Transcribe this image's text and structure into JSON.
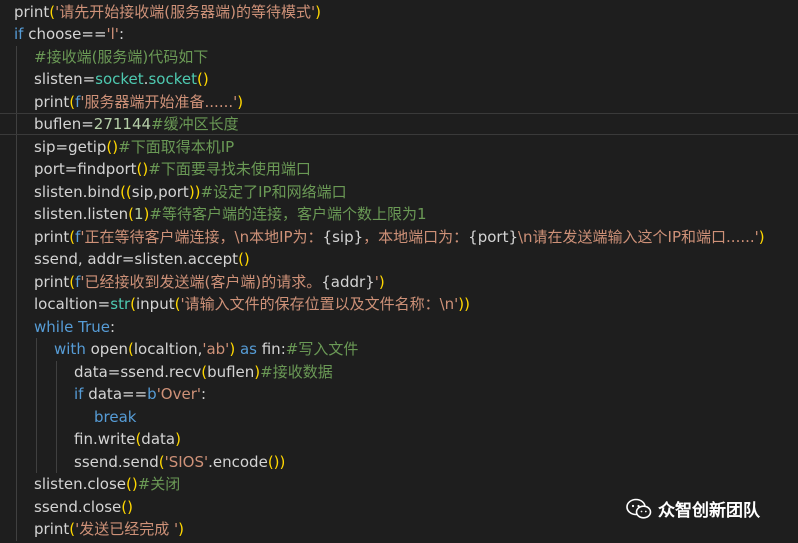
{
  "code": {
    "lines": [
      {
        "indent": 0,
        "tokens": [
          {
            "t": "print",
            "c": "w"
          },
          {
            "t": "(",
            "c": "br"
          },
          {
            "t": "'请先开始接收端(服务器端)的等待模式'",
            "c": "str"
          },
          {
            "t": ")",
            "c": "br"
          }
        ]
      },
      {
        "indent": 0,
        "tokens": [
          {
            "t": "if",
            "c": "kw"
          },
          {
            "t": " choose==",
            "c": "w"
          },
          {
            "t": "'l'",
            "c": "str"
          },
          {
            "t": ":",
            "c": "w"
          }
        ]
      },
      {
        "indent": 1,
        "tokens": [
          {
            "t": "#接收端(服务端)代码如下",
            "c": "cm"
          }
        ]
      },
      {
        "indent": 1,
        "tokens": [
          {
            "t": "slisten=",
            "c": "w"
          },
          {
            "t": "socket",
            "c": "cls"
          },
          {
            "t": ".",
            "c": "w"
          },
          {
            "t": "socket",
            "c": "cls"
          },
          {
            "t": "()",
            "c": "br"
          }
        ]
      },
      {
        "indent": 1,
        "tokens": [
          {
            "t": "print",
            "c": "w"
          },
          {
            "t": "(",
            "c": "br"
          },
          {
            "t": "f",
            "c": "kw"
          },
          {
            "t": "'服务器端开始准备......'",
            "c": "str"
          },
          {
            "t": ")",
            "c": "br"
          }
        ]
      },
      {
        "indent": 1,
        "active": true,
        "tokens": [
          {
            "t": "buflen=",
            "c": "w"
          },
          {
            "t": "271144",
            "c": "num"
          },
          {
            "t": "#缓冲区长度",
            "c": "cm"
          }
        ]
      },
      {
        "indent": 1,
        "tokens": [
          {
            "t": "sip=getip",
            "c": "w"
          },
          {
            "t": "()",
            "c": "br"
          },
          {
            "t": "#下面取得本机IP",
            "c": "cm"
          }
        ]
      },
      {
        "indent": 1,
        "tokens": [
          {
            "t": "port=findport",
            "c": "w"
          },
          {
            "t": "()",
            "c": "br"
          },
          {
            "t": "#下面要寻找未使用端口",
            "c": "cm"
          }
        ]
      },
      {
        "indent": 1,
        "tokens": [
          {
            "t": "slisten.bind",
            "c": "w"
          },
          {
            "t": "((",
            "c": "br"
          },
          {
            "t": "sip,port",
            "c": "w"
          },
          {
            "t": "))",
            "c": "br"
          },
          {
            "t": "#设定了IP和网络端口",
            "c": "cm"
          }
        ]
      },
      {
        "indent": 1,
        "tokens": [
          {
            "t": "slisten.listen",
            "c": "w"
          },
          {
            "t": "(",
            "c": "br"
          },
          {
            "t": "1",
            "c": "num"
          },
          {
            "t": ")",
            "c": "br"
          },
          {
            "t": "#等待客户端的连接，客户端个数上限为1",
            "c": "cm"
          }
        ]
      },
      {
        "indent": 1,
        "tokens": [
          {
            "t": "print",
            "c": "w"
          },
          {
            "t": "(",
            "c": "br"
          },
          {
            "t": "f",
            "c": "kw"
          },
          {
            "t": "'正在等待客户端连接，\\n本地IP为：",
            "c": "str"
          },
          {
            "t": "{sip}",
            "c": "w"
          },
          {
            "t": "，本地端口为：",
            "c": "str"
          },
          {
            "t": "{port}",
            "c": "w"
          },
          {
            "t": "\\n请在发送端输入这个IP和端口......'",
            "c": "str"
          },
          {
            "t": ")",
            "c": "br"
          }
        ]
      },
      {
        "indent": 1,
        "tokens": [
          {
            "t": "ssend, addr=slisten.accept",
            "c": "w"
          },
          {
            "t": "()",
            "c": "br"
          }
        ]
      },
      {
        "indent": 1,
        "tokens": [
          {
            "t": "print",
            "c": "w"
          },
          {
            "t": "(",
            "c": "br"
          },
          {
            "t": "f",
            "c": "kw"
          },
          {
            "t": "'已经接收到发送端(客户端)的请求。",
            "c": "str"
          },
          {
            "t": "{addr}",
            "c": "w"
          },
          {
            "t": "'",
            "c": "str"
          },
          {
            "t": ")",
            "c": "br"
          }
        ]
      },
      {
        "indent": 1,
        "tokens": [
          {
            "t": "localtion=",
            "c": "w"
          },
          {
            "t": "str",
            "c": "cls"
          },
          {
            "t": "(",
            "c": "br"
          },
          {
            "t": "input",
            "c": "w"
          },
          {
            "t": "(",
            "c": "br"
          },
          {
            "t": "'请输入文件的保存位置以及文件名称：\\n'",
            "c": "str"
          },
          {
            "t": "))",
            "c": "br"
          }
        ]
      },
      {
        "indent": 1,
        "tokens": [
          {
            "t": "while",
            "c": "kw"
          },
          {
            "t": " ",
            "c": "w"
          },
          {
            "t": "True",
            "c": "kw"
          },
          {
            "t": ":",
            "c": "w"
          }
        ]
      },
      {
        "indent": 2,
        "tokens": [
          {
            "t": "with",
            "c": "kw"
          },
          {
            "t": " open",
            "c": "w"
          },
          {
            "t": "(",
            "c": "br"
          },
          {
            "t": "localtion,",
            "c": "w"
          },
          {
            "t": "'ab'",
            "c": "str"
          },
          {
            "t": ")",
            "c": "br"
          },
          {
            "t": " ",
            "c": "w"
          },
          {
            "t": "as",
            "c": "kw"
          },
          {
            "t": " fin:",
            "c": "w"
          },
          {
            "t": "#写入文件",
            "c": "cm"
          }
        ]
      },
      {
        "indent": 3,
        "tokens": [
          {
            "t": "data=ssend.recv",
            "c": "w"
          },
          {
            "t": "(",
            "c": "br"
          },
          {
            "t": "buflen",
            "c": "w"
          },
          {
            "t": ")",
            "c": "br"
          },
          {
            "t": "#接收数据",
            "c": "cm"
          }
        ]
      },
      {
        "indent": 3,
        "tokens": [
          {
            "t": "if",
            "c": "kw"
          },
          {
            "t": " data==",
            "c": "w"
          },
          {
            "t": "b",
            "c": "kw"
          },
          {
            "t": "'Over'",
            "c": "str"
          },
          {
            "t": ":",
            "c": "w"
          }
        ]
      },
      {
        "indent": 4,
        "tokens": [
          {
            "t": "break",
            "c": "kw"
          }
        ]
      },
      {
        "indent": 3,
        "tokens": [
          {
            "t": "fin.write",
            "c": "w"
          },
          {
            "t": "(",
            "c": "br"
          },
          {
            "t": "data",
            "c": "w"
          },
          {
            "t": ")",
            "c": "br"
          }
        ]
      },
      {
        "indent": 3,
        "tokens": [
          {
            "t": "ssend.send",
            "c": "w"
          },
          {
            "t": "(",
            "c": "br"
          },
          {
            "t": "'SIOS'",
            "c": "str"
          },
          {
            "t": ".encode",
            "c": "w"
          },
          {
            "t": "())",
            "c": "br"
          }
        ]
      },
      {
        "indent": 1,
        "tokens": [
          {
            "t": "slisten.close",
            "c": "w"
          },
          {
            "t": "()",
            "c": "br"
          },
          {
            "t": "#关闭",
            "c": "cm"
          }
        ]
      },
      {
        "indent": 1,
        "tokens": [
          {
            "t": "ssend.close",
            "c": "w"
          },
          {
            "t": "()",
            "c": "br"
          }
        ]
      },
      {
        "indent": 1,
        "tokens": [
          {
            "t": "print",
            "c": "w"
          },
          {
            "t": "(",
            "c": "br"
          },
          {
            "t": "'发送已经完成 '",
            "c": "str"
          },
          {
            "t": ")",
            "c": "br"
          }
        ]
      }
    ]
  },
  "watermark": {
    "icon": "wechat-icon",
    "text": "众智创新团队"
  }
}
